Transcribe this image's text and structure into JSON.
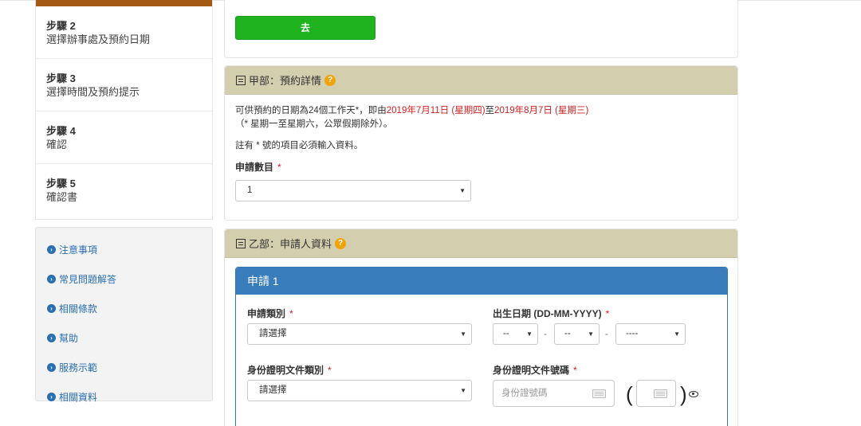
{
  "steps": [
    {
      "title": "步驟 2",
      "desc": "選擇辦事處及預約日期"
    },
    {
      "title": "步驟 3",
      "desc": "選擇時間及預約提示"
    },
    {
      "title": "步驟 4",
      "desc": "確認"
    },
    {
      "title": "步驟 5",
      "desc": "確認書"
    }
  ],
  "links": [
    "注意事項",
    "常見問題解答",
    "相關條款",
    "幫助",
    "服務示範",
    "相關資料"
  ],
  "go_button": "去",
  "section_a": {
    "title": "甲部：預約詳情",
    "line1_prefix": "可供預約的日期為24個工作天*，即由",
    "date_start": "2019年7月11日 (星期四)",
    "line1_mid": "至",
    "date_end": "2019年8月7日 (星期三)",
    "line2": "（* 星期一至星期六，公眾假期除外）。",
    "note": "註有 * 號的項目必須輸入資料。",
    "count_label": "申請數目",
    "count_value": "1"
  },
  "section_b": {
    "title": "乙部：申請人資料",
    "applicant_title": "申請 1",
    "category_label": "申請類別",
    "category_value": "請選擇",
    "dob_label": "出生日期 (DD-MM-YYYY)",
    "dob_day": "--",
    "dob_month": "--",
    "dob_year": "----",
    "dob_sep": "-",
    "id_type_label": "身份證明文件類別",
    "id_type_value": "請選擇",
    "id_no_label": "身份證明文件號碼",
    "id_no_placeholder": "身份證號碼",
    "paren_open": "(",
    "paren_close": ")"
  },
  "required_mark": "*",
  "icons": {
    "step_link": "arrow-circle-right-icon",
    "section": "document-icon",
    "help": "question-circle-icon",
    "keyboard": "keyboard-icon",
    "reveal": "eye-icon",
    "dropdown": "caret-down-icon"
  },
  "colors": {
    "steps_bar": "#a55a14",
    "go_button": "#1fb31f",
    "section_header": "#d3ceae",
    "applicant_header": "#3a7dbc",
    "link": "#2a6fb0",
    "highlight": "#d21f1f",
    "help": "#f0a30a"
  }
}
